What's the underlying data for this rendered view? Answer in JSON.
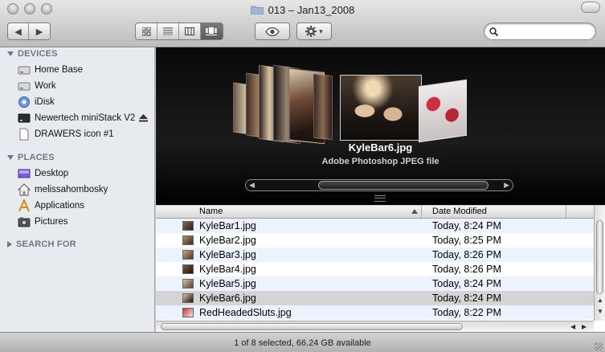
{
  "window": {
    "title": "013 – Jan13_2008"
  },
  "toolbar": {
    "back_glyph": "◀",
    "forward_glyph": "▶",
    "search_placeholder": "",
    "gear_caret": "▾"
  },
  "sidebar": {
    "devices_heading": "DEVICES",
    "devices": [
      {
        "label": "Home Base",
        "icon": "hard-drive-icon"
      },
      {
        "label": "Work",
        "icon": "hard-drive-icon"
      },
      {
        "label": "iDisk",
        "icon": "idisk-icon"
      },
      {
        "label": "Newertech miniStack V2",
        "icon": "external-drive-icon"
      },
      {
        "label": "DRAWERS icon #1",
        "icon": "document-icon"
      }
    ],
    "places_heading": "PLACES",
    "places": [
      {
        "label": "Desktop",
        "icon": "desktop-icon"
      },
      {
        "label": "melissahombosky",
        "icon": "home-icon"
      },
      {
        "label": "Applications",
        "icon": "applications-icon"
      },
      {
        "label": "Pictures",
        "icon": "pictures-icon"
      }
    ],
    "search_heading": "SEARCH FOR"
  },
  "coverflow": {
    "selected_name": "KyleBar6.jpg",
    "selected_kind": "Adobe Photoshop JPEG file"
  },
  "list": {
    "columns": {
      "name": "Name",
      "date": "Date Modified"
    },
    "rows": [
      {
        "name": "KyleBar1.jpg",
        "date": "Today, 8:24 PM"
      },
      {
        "name": "KyleBar2.jpg",
        "date": "Today, 8:25 PM"
      },
      {
        "name": "KyleBar3.jpg",
        "date": "Today, 8:26 PM"
      },
      {
        "name": "KyleBar4.jpg",
        "date": "Today, 8:26 PM"
      },
      {
        "name": "KyleBar5.jpg",
        "date": "Today, 8:24 PM"
      },
      {
        "name": "KyleBar6.jpg",
        "date": "Today, 8:24 PM"
      },
      {
        "name": "RedHeadedSluts.jpg",
        "date": "Today, 8:22 PM"
      }
    ],
    "selected_index": 5
  },
  "status": {
    "text": "1 of 8 selected, 66.24 GB available"
  }
}
